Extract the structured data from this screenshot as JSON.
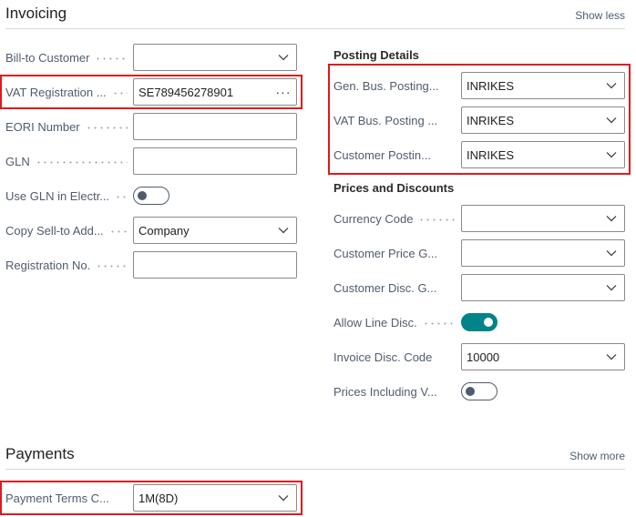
{
  "invoicing": {
    "title": "Invoicing",
    "toggle_link": "Show less",
    "left_fields": [
      {
        "label": "Bill-to Customer",
        "value": ""
      },
      {
        "label": "VAT Registration ...",
        "value": "SE789456278901",
        "action": "···"
      },
      {
        "label": "EORI Number",
        "value": ""
      },
      {
        "label": "GLN",
        "value": ""
      },
      {
        "label": "Use GLN in Electr...",
        "toggle": false
      },
      {
        "label": "Copy Sell-to Add...",
        "value": "Company"
      },
      {
        "label": "Registration No.",
        "value": ""
      }
    ],
    "posting_details": {
      "title": "Posting Details",
      "fields": [
        {
          "label": "Gen. Bus. Posting...",
          "value": "INRIKES"
        },
        {
          "label": "VAT Bus. Posting ...",
          "value": "INRIKES"
        },
        {
          "label": "Customer Postin...",
          "value": "INRIKES"
        }
      ]
    },
    "prices_discounts": {
      "title": "Prices and Discounts",
      "fields": [
        {
          "label": "Currency Code",
          "value": ""
        },
        {
          "label": "Customer Price G...",
          "value": ""
        },
        {
          "label": "Customer Disc. G...",
          "value": ""
        },
        {
          "label": "Allow Line Disc.",
          "toggle": true
        },
        {
          "label": "Invoice Disc. Code",
          "value": "10000"
        },
        {
          "label": "Prices Including V...",
          "toggle": false
        }
      ]
    }
  },
  "payments": {
    "title": "Payments",
    "toggle_link": "Show more",
    "fields": [
      {
        "label": "Payment Terms C...",
        "value": "1M(8D)"
      }
    ]
  },
  "colors": {
    "highlight": "#e0191f",
    "toggle_on": "#008489",
    "label": "#505c6d"
  }
}
